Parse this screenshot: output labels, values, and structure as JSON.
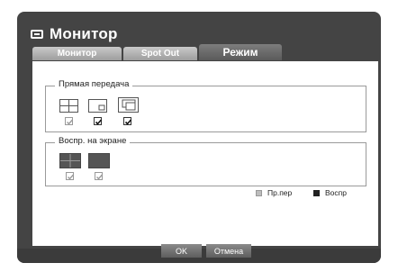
{
  "window": {
    "title": "Монитор",
    "title_icon": "monitor-icon"
  },
  "tabs": [
    {
      "label": "Монитор",
      "active": false
    },
    {
      "label": "Spot Out",
      "active": false
    },
    {
      "label": "Режим",
      "active": true
    }
  ],
  "live_group": {
    "label": "Прямая передача",
    "items": [
      {
        "icon": "quad-layout-icon",
        "checked": true,
        "enabled": false
      },
      {
        "icon": "pip-layout-icon",
        "checked": true,
        "enabled": true
      },
      {
        "icon": "cascade-layout-icon",
        "checked": true,
        "enabled": true
      }
    ]
  },
  "playback_group": {
    "label": "Воспр. на экране",
    "items": [
      {
        "icon": "quad-layout-filled-icon",
        "checked": true,
        "enabled": false
      },
      {
        "icon": "single-layout-filled-icon",
        "checked": true,
        "enabled": false
      }
    ]
  },
  "legend": {
    "live": "Пр.пер",
    "playback": "Воспр"
  },
  "buttons": {
    "ok": "OK",
    "cancel": "Отмена"
  },
  "colors": {
    "frame": "#444444",
    "panel": "#ffffff",
    "tab_active": "#666666",
    "tab_inactive": "#b5b5b5"
  }
}
